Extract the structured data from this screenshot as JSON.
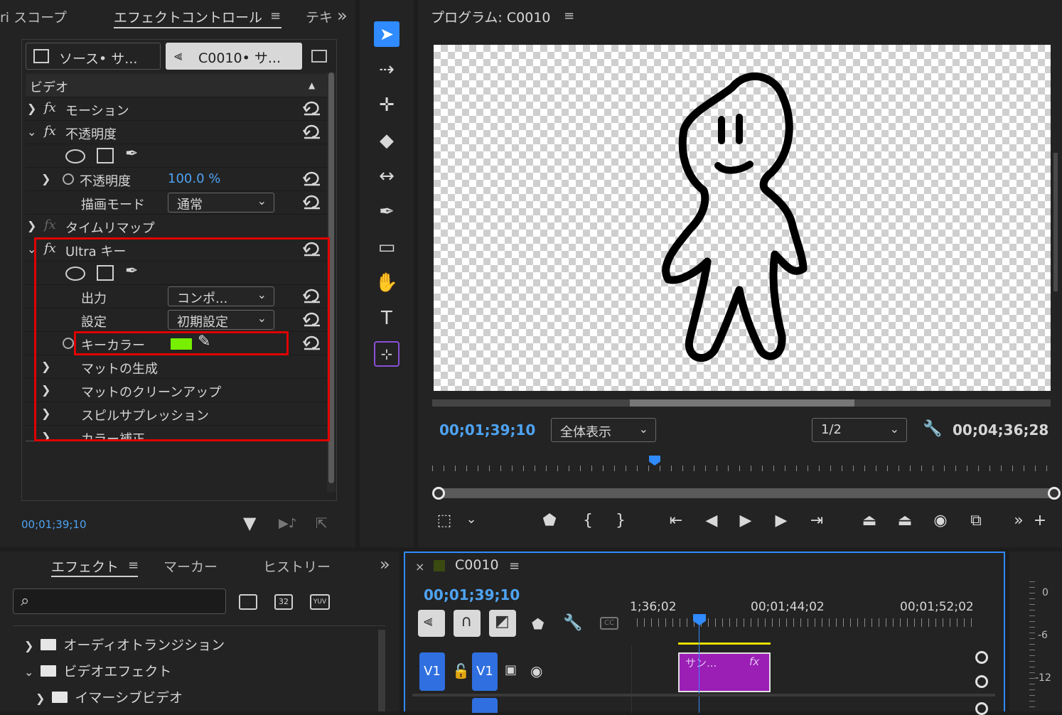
{
  "effect_controls": {
    "tab_scopes": "ri スコープ",
    "tab_active": "エフェクトコントロール",
    "tab_text": "テキ",
    "overflow": "»",
    "source_label": "ソース• サ...",
    "clip_label": "C0010• サ...",
    "video_header": "ビデオ",
    "motion": "モーション",
    "opacity_group": "不透明度",
    "opacity_param": "不透明度",
    "opacity_value": "100.0 %",
    "blend_mode_label": "描画モード",
    "blend_mode_value": "通常",
    "time_remap": "タイムリマップ",
    "ultra_key": "Ultra キー",
    "output_label": "出力",
    "output_value": "コンポ...",
    "setting_label": "設定",
    "setting_value": "初期設定",
    "key_color_label": "キーカラー",
    "key_color": "#76f000",
    "matte_gen": "マットの生成",
    "matte_cleanup": "マットのクリーンアップ",
    "spill": "スピルサプレッション",
    "color_correction": "カラー補正",
    "timecode": "00;01;39;10"
  },
  "tools": [
    "selection-tool",
    "track-select-tool",
    "ripple-edit-tool",
    "razor-tool",
    "slip-tool",
    "pen-tool",
    "rectangle-tool",
    "hand-tool",
    "type-tool",
    "remix-tool"
  ],
  "program_monitor": {
    "title": "プログラム: C0010",
    "timecode": "00;01;39;10",
    "zoom": "全体表示",
    "resolution": "1/2",
    "duration": "00;04;36;28"
  },
  "effects_panel": {
    "tab_effects": "エフェクト",
    "tab_markers": "マーカー",
    "tab_history": "ヒストリー",
    "overflow": "»",
    "search_placeholder": "",
    "badge_32": "32",
    "badge_yuv": "YUV",
    "folders": [
      "オーディオトランジション",
      "ビデオエフェクト",
      "イマーシブビデオ"
    ]
  },
  "timeline": {
    "close": "×",
    "sequence": "C0010",
    "timecode": "00;01;39;10",
    "ruler": [
      "1;36;02",
      "00;01;44;02",
      "00;01;52;02"
    ],
    "track_v1_src": "V1",
    "track_v1": "V1",
    "clip_name": "サン...",
    "clip_fx": "fx",
    "clip_color": "#9b1fb5",
    "meter": [
      "0",
      "-6",
      "-12"
    ]
  },
  "colors": {
    "accent_blue": "#2f8bff",
    "highlight_red": "#e00000",
    "timecode_blue": "#4ea3f2"
  }
}
